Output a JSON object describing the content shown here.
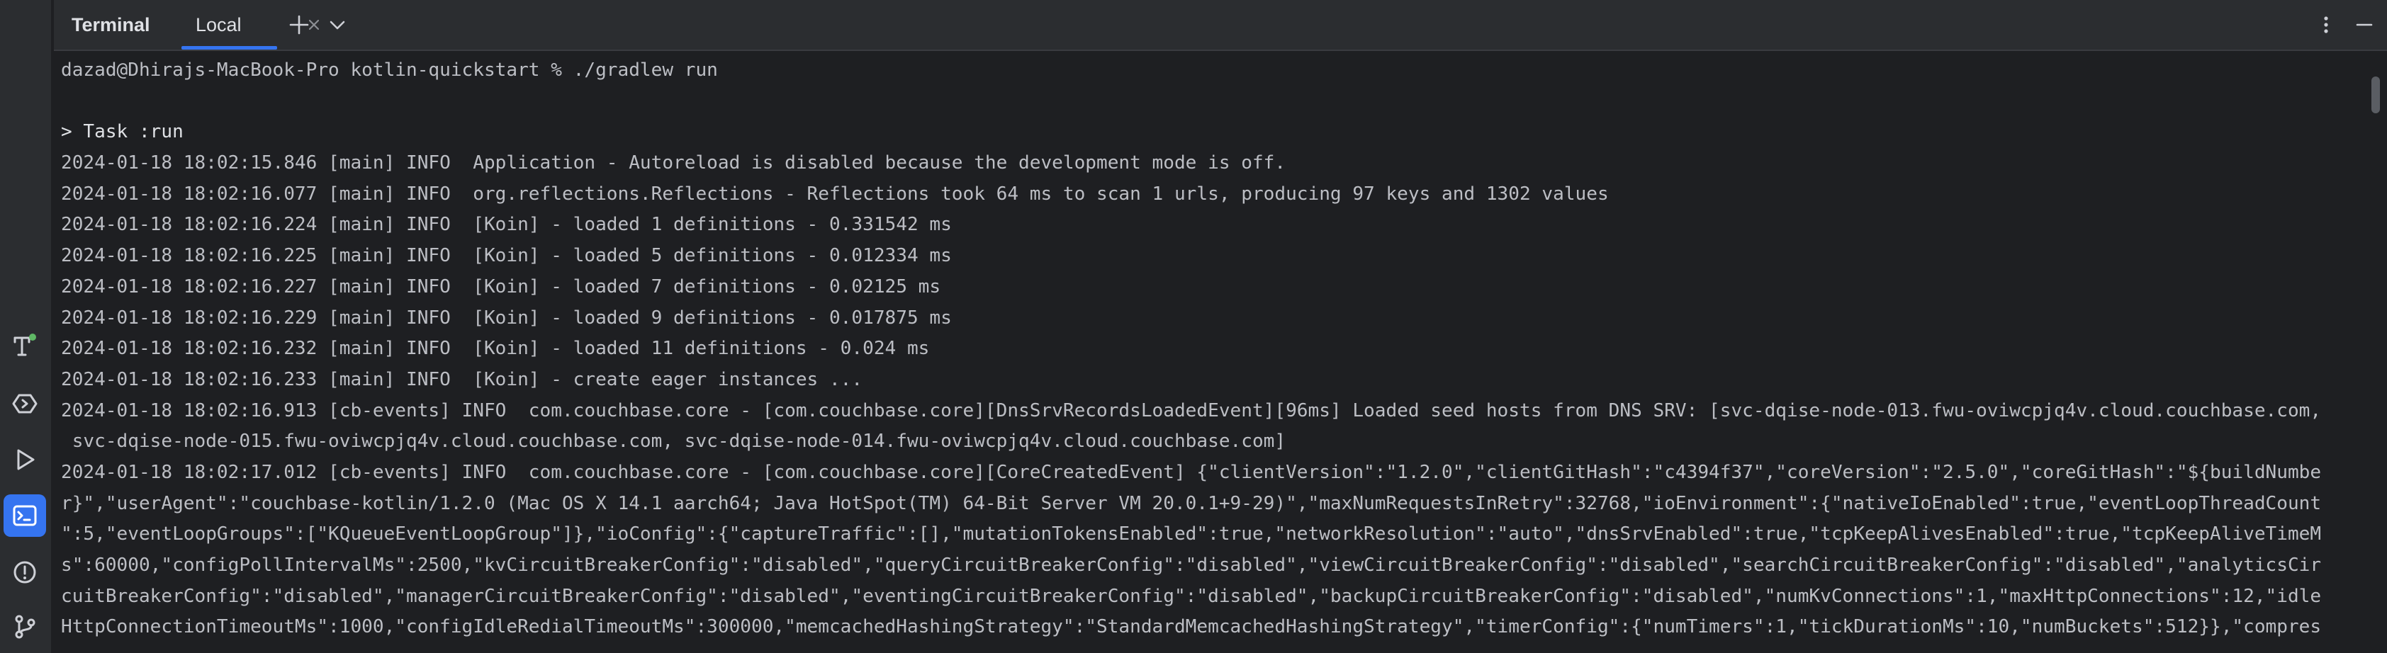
{
  "header": {
    "tool_title": "Terminal",
    "tabs": [
      {
        "label": "Local",
        "active": true
      }
    ]
  },
  "left_strip": {
    "icons": [
      "build-icon",
      "services-icon",
      "run-icon",
      "terminal-icon",
      "problems-icon",
      "git-icon"
    ],
    "active": "terminal-icon"
  },
  "colors": {
    "background": "#1e1f22",
    "panel": "#2b2d30",
    "accent": "#3574f0",
    "text": "#bcbec4",
    "status_dot": "#5fb865"
  },
  "terminal": {
    "lines": [
      "dazad@Dhirajs-MacBook-Pro kotlin-quickstart % ./gradlew run",
      "",
      "> Task :run",
      "2024-01-18 18:02:15.846 [main] INFO  Application - Autoreload is disabled because the development mode is off.",
      "2024-01-18 18:02:16.077 [main] INFO  org.reflections.Reflections - Reflections took 64 ms to scan 1 urls, producing 97 keys and 1302 values",
      "2024-01-18 18:02:16.224 [main] INFO  [Koin] - loaded 1 definitions - 0.331542 ms",
      "2024-01-18 18:02:16.225 [main] INFO  [Koin] - loaded 5 definitions - 0.012334 ms",
      "2024-01-18 18:02:16.227 [main] INFO  [Koin] - loaded 7 definitions - 0.02125 ms",
      "2024-01-18 18:02:16.229 [main] INFO  [Koin] - loaded 9 definitions - 0.017875 ms",
      "2024-01-18 18:02:16.232 [main] INFO  [Koin] - loaded 11 definitions - 0.024 ms",
      "2024-01-18 18:02:16.233 [main] INFO  [Koin] - create eager instances ...",
      "2024-01-18 18:02:16.913 [cb-events] INFO  com.couchbase.core - [com.couchbase.core][DnsSrvRecordsLoadedEvent][96ms] Loaded seed hosts from DNS SRV: [svc-dqise-node-013.fwu-oviwcpjq4v.cloud.couchbase.com,",
      " svc-dqise-node-015.fwu-oviwcpjq4v.cloud.couchbase.com, svc-dqise-node-014.fwu-oviwcpjq4v.cloud.couchbase.com]",
      "2024-01-18 18:02:17.012 [cb-events] INFO  com.couchbase.core - [com.couchbase.core][CoreCreatedEvent] {\"clientVersion\":\"1.2.0\",\"clientGitHash\":\"c4394f37\",\"coreVersion\":\"2.5.0\",\"coreGitHash\":\"${buildNumbe",
      "r}\",\"userAgent\":\"couchbase-kotlin/1.2.0 (Mac OS X 14.1 aarch64; Java HotSpot(TM) 64-Bit Server VM 20.0.1+9-29)\",\"maxNumRequestsInRetry\":32768,\"ioEnvironment\":{\"nativeIoEnabled\":true,\"eventLoopThreadCount",
      "\":5,\"eventLoopGroups\":[\"KQueueEventLoopGroup\"]},\"ioConfig\":{\"captureTraffic\":[],\"mutationTokensEnabled\":true,\"networkResolution\":\"auto\",\"dnsSrvEnabled\":true,\"tcpKeepAlivesEnabled\":true,\"tcpKeepAliveTimeM",
      "s\":60000,\"configPollIntervalMs\":2500,\"kvCircuitBreakerConfig\":\"disabled\",\"queryCircuitBreakerConfig\":\"disabled\",\"viewCircuitBreakerConfig\":\"disabled\",\"searchCircuitBreakerConfig\":\"disabled\",\"analyticsCir",
      "cuitBreakerConfig\":\"disabled\",\"managerCircuitBreakerConfig\":\"disabled\",\"eventingCircuitBreakerConfig\":\"disabled\",\"backupCircuitBreakerConfig\":\"disabled\",\"numKvConnections\":1,\"maxHttpConnections\":12,\"idle",
      "HttpConnectionTimeoutMs\":1000,\"configIdleRedialTimeoutMs\":300000,\"memcachedHashingStrategy\":\"StandardMemcachedHashingStrategy\",\"timerConfig\":{\"numTimers\":1,\"tickDurationMs\":10,\"numBuckets\":512}},\"compres"
    ]
  }
}
